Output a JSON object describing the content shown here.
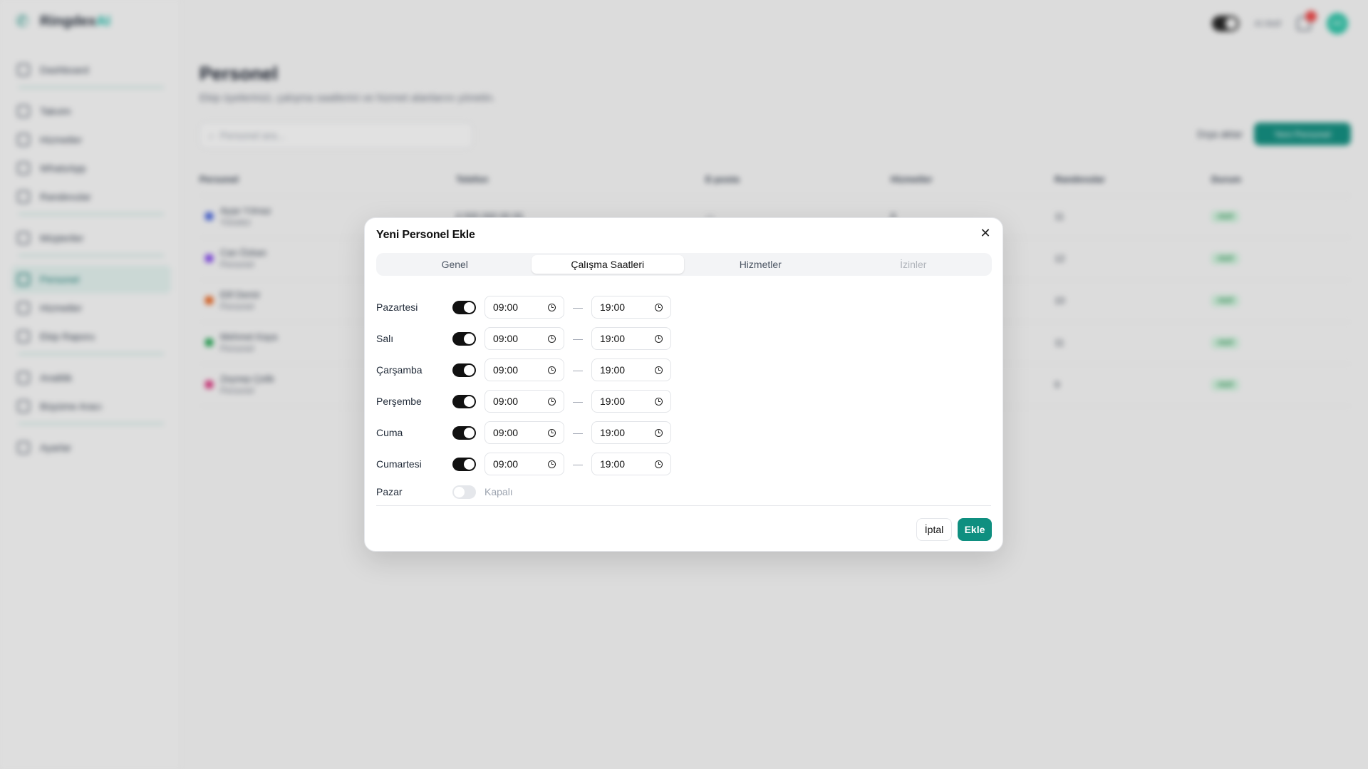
{
  "app": {
    "brand": "Ringdex",
    "brand_suffix": "AI"
  },
  "sidebar": {
    "items": [
      {
        "label": "Dashboard"
      },
      {
        "label": "Takvim"
      },
      {
        "label": "Hizmetler"
      },
      {
        "label": "WhatsApp"
      },
      {
        "label": "Randevular"
      },
      {
        "label": "Müşteriler"
      },
      {
        "label": "Personel"
      },
      {
        "label": "Hizmetler"
      },
      {
        "label": "Ekip Raporu"
      },
      {
        "label": "Analitik"
      },
      {
        "label": "Büyüme Aracı"
      },
      {
        "label": "Ayarlar"
      }
    ]
  },
  "topbar": {
    "status": "AI Aktif",
    "avatar": "AD"
  },
  "page": {
    "title": "Personel",
    "subtitle": "Ekip üyelerinizi, çalışma saatlerini ve hizmet alanlarını yönetin.",
    "search_placeholder": "Personel ara...",
    "export_label": "Dışa aktar",
    "new_button": "Yeni Personel"
  },
  "table": {
    "headers": [
      "Personel",
      "Telefon",
      "E-posta",
      "Hizmetler",
      "Randevular",
      "Durum"
    ],
    "rows": [
      {
        "name": "Ayşe Yılmaz",
        "role": "Yönetici",
        "phone": "0 555 000 00 00",
        "email": "—",
        "services": "8",
        "appointments": "11",
        "status": "Aktif",
        "color": "#3b5bdb"
      },
      {
        "name": "Can Özkan",
        "role": "Personel",
        "phone": "",
        "email": "",
        "services": "",
        "appointments": "12",
        "status": "Aktif",
        "color": "#7c3aed"
      },
      {
        "name": "Elif Demir",
        "role": "Personel",
        "phone": "",
        "email": "",
        "services": "",
        "appointments": "10",
        "status": "Aktif",
        "color": "#ea580c"
      },
      {
        "name": "Mehmet Kaya",
        "role": "Personel",
        "phone": "",
        "email": "",
        "services": "",
        "appointments": "11",
        "status": "Aktif",
        "color": "#16a34a"
      },
      {
        "name": "Zeynep Çelik",
        "role": "Personel",
        "phone": "",
        "email": "",
        "services": "",
        "appointments": "9",
        "status": "Aktif",
        "color": "#db2777"
      }
    ]
  },
  "modal": {
    "title": "Yeni Personel Ekle",
    "tabs": [
      "Genel",
      "Çalışma Saatleri",
      "Hizmetler",
      "İzinler"
    ],
    "active_tab": "Çalışma Saatleri",
    "days": [
      {
        "name": "Pazartesi",
        "enabled": true,
        "start": "09:00",
        "end": "19:00"
      },
      {
        "name": "Salı",
        "enabled": true,
        "start": "09:00",
        "end": "19:00"
      },
      {
        "name": "Çarşamba",
        "enabled": true,
        "start": "09:00",
        "end": "19:00"
      },
      {
        "name": "Perşembe",
        "enabled": true,
        "start": "09:00",
        "end": "19:00"
      },
      {
        "name": "Cuma",
        "enabled": true,
        "start": "09:00",
        "end": "19:00"
      },
      {
        "name": "Cumartesi",
        "enabled": true,
        "start": "09:00",
        "end": "19:00"
      },
      {
        "name": "Pazar",
        "enabled": false,
        "closed_label": "Kapalı"
      }
    ],
    "separator": "—",
    "cancel_label": "İptal",
    "submit_label": "Ekle"
  },
  "colors": {
    "accent": "#0f8f80",
    "toggle_on": "#111111",
    "toggle_off": "#e5e7eb"
  }
}
